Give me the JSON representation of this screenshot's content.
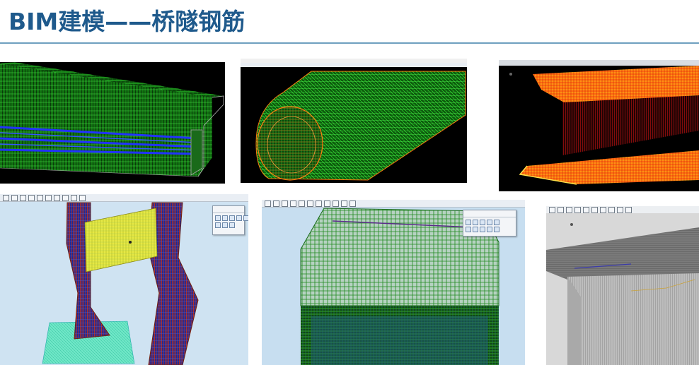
{
  "title": "BIM建模——桥隧钢筋",
  "panels": [
    {
      "name": "bridge-girder-rebar-green-blue"
    },
    {
      "name": "tunnel-lining-rebar-green"
    },
    {
      "name": "bridge-deck-rebar-orange"
    },
    {
      "name": "pier-column-rebar-blue-red"
    },
    {
      "name": "abutment-rebar-green"
    },
    {
      "name": "deck-slab-rebar-gray"
    }
  ],
  "colors": {
    "title": "#1f5a8c",
    "rule": "#6fa0bf"
  },
  "icons": [
    "toolbar-icon",
    "floating-toolbox-icon"
  ]
}
